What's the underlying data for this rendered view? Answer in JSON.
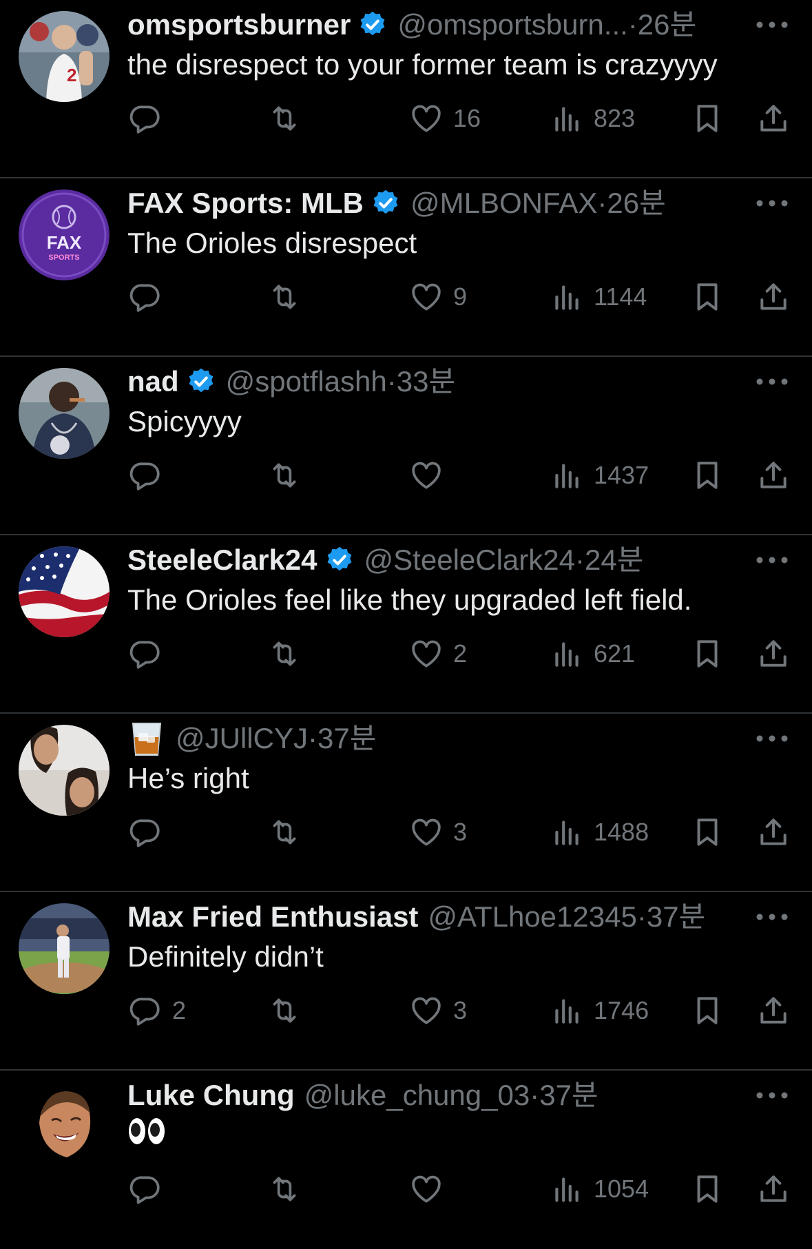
{
  "colors": {
    "background": "#000000",
    "text_primary": "#e7e9ea",
    "text_secondary": "#71767b",
    "divider": "#2f3336",
    "verified_blue": "#1d9bf0"
  },
  "icons": {
    "reply": "speech-bubble-icon",
    "retweet": "retweet-arrows-icon",
    "like": "heart-icon",
    "views": "bar-chart-icon",
    "bookmark": "bookmark-icon",
    "share": "share-upload-icon",
    "more": "ellipsis-icon",
    "verified": "verified-badge-icon"
  },
  "tweets": [
    {
      "name": "omsportsburner",
      "verified": true,
      "handle": "@omsportsburn...",
      "dot": "·",
      "time": "26분",
      "text": "the disrespect to your former team is crazyyyy",
      "replies": "",
      "retweets": "",
      "likes": "16",
      "views": "823"
    },
    {
      "name": "FAX Sports: MLB",
      "verified": true,
      "handle": "@MLBONFAX",
      "dot": "·",
      "time": "26분",
      "text": "The Orioles disrespect",
      "replies": "",
      "retweets": "",
      "likes": "9",
      "views": "1144",
      "avatar_text": "FAX",
      "avatar_subtext": "SPORTS"
    },
    {
      "name": "nad",
      "verified": true,
      "handle": "@spotflashh",
      "dot": "·",
      "time": "33분",
      "text": "Spicyyyy",
      "replies": "",
      "retweets": "",
      "likes": "",
      "views": "1437"
    },
    {
      "name": "SteeleClark24",
      "verified": true,
      "handle": "@SteeleClark24",
      "dot": "·",
      "time": "24분",
      "text": "The Orioles feel like they upgraded left field.",
      "replies": "",
      "retweets": "",
      "likes": "2",
      "views": "621"
    },
    {
      "name": "",
      "name_emoji": "tumbler-glass-emoji",
      "verified": false,
      "handle": "@JUllCYJ",
      "dot": "·",
      "time": "37분",
      "text": "He’s right",
      "replies": "",
      "retweets": "",
      "likes": "3",
      "views": "1488"
    },
    {
      "name": "Max Fried Enthusiast",
      "verified": false,
      "handle": "@ATLhoe12345",
      "dot": "·",
      "time": "37분",
      "text": "Definitely didn’t",
      "replies": "2",
      "retweets": "",
      "likes": "3",
      "views": "1746"
    },
    {
      "name": "Luke Chung",
      "verified": false,
      "handle": "@luke_chung_03",
      "dot": "·",
      "time": "37분",
      "text": "",
      "text_emoji": "eyes-emoji",
      "replies": "",
      "retweets": "",
      "likes": "",
      "views": "1054"
    }
  ]
}
